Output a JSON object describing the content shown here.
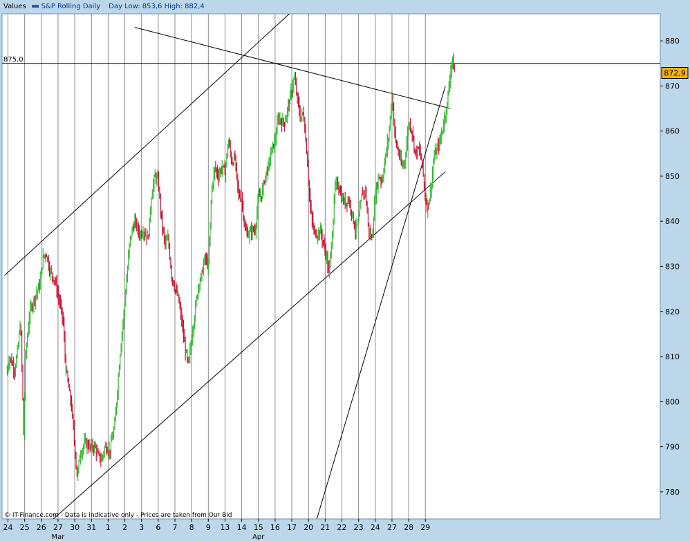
{
  "legend": {
    "values_label": "Values",
    "series_name": "S&P Rolling Daily",
    "day_range": "Day Low: 853,6 High: 882,4"
  },
  "footer_note": "© IT-Finance.com - Data is indicative only - Prices are taken from Our Bid",
  "colors": {
    "up": "#2db82d",
    "down": "#c8102e",
    "grid": "#888888",
    "background_plot": "#ffffff",
    "background_frame": "#bcd7ea",
    "price_marker": "#f4b400"
  },
  "chart_data": {
    "type": "candlestick",
    "title": "",
    "xlabel": "",
    "ylabel": "",
    "ylim": [
      774,
      886
    ],
    "y_ticks": [
      780,
      790,
      800,
      810,
      820,
      830,
      840,
      850,
      860,
      870,
      880
    ],
    "x_tick_labels": [
      "24",
      "25",
      "26",
      "27",
      "30",
      "31",
      "1",
      "2",
      "3",
      "6",
      "7",
      "8",
      "9",
      "13",
      "14",
      "15",
      "16",
      "17",
      "20",
      "21",
      "22",
      "23",
      "24",
      "27",
      "28",
      "29"
    ],
    "month_labels": [
      {
        "label": "Mar",
        "at_tick": "27"
      },
      {
        "label": "Apr",
        "at_tick": "15"
      }
    ],
    "horizontal_line": {
      "value": 875.0,
      "label": "875,0"
    },
    "last_price": {
      "value": 872.9,
      "label": "872,9"
    },
    "trendlines": [
      {
        "name": "upper-channel",
        "from": {
          "tick": -0.2,
          "value": 828
        },
        "to": {
          "tick": 24.2,
          "value": 911
        }
      },
      {
        "name": "lower-channel",
        "from": {
          "tick": 1.5,
          "value": 770
        },
        "to": {
          "tick": 26.2,
          "value": 851
        }
      },
      {
        "name": "descending-resistance",
        "from": {
          "tick": 7.6,
          "value": 883
        },
        "to": {
          "tick": 26.5,
          "value": 865
        }
      },
      {
        "name": "steep-support",
        "from": {
          "tick": 18.5,
          "value": 774
        },
        "to": {
          "tick": 26.2,
          "value": 870
        }
      }
    ],
    "anchors": [
      [
        -0.1,
        806
      ],
      [
        0.1,
        810
      ],
      [
        0.4,
        807
      ],
      [
        0.6,
        812
      ],
      [
        0.75,
        818
      ],
      [
        0.85,
        806
      ],
      [
        0.95,
        792
      ],
      [
        1.05,
        810
      ],
      [
        1.3,
        820
      ],
      [
        1.6,
        823
      ],
      [
        1.9,
        826
      ],
      [
        2.1,
        832
      ],
      [
        2.3,
        833
      ],
      [
        2.5,
        829
      ],
      [
        2.8,
        827
      ],
      [
        3.1,
        822
      ],
      [
        3.3,
        818
      ],
      [
        3.45,
        808
      ],
      [
        3.6,
        804
      ],
      [
        3.8,
        799
      ],
      [
        4.0,
        790
      ],
      [
        4.15,
        783
      ],
      [
        4.3,
        788
      ],
      [
        4.6,
        791
      ],
      [
        4.9,
        790
      ],
      [
        5.2,
        790
      ],
      [
        5.4,
        788
      ],
      [
        5.6,
        787
      ],
      [
        5.8,
        790
      ],
      [
        6.1,
        789
      ],
      [
        6.4,
        795
      ],
      [
        6.7,
        810
      ],
      [
        7.0,
        822
      ],
      [
        7.3,
        836
      ],
      [
        7.6,
        840
      ],
      [
        7.9,
        837
      ],
      [
        8.1,
        838
      ],
      [
        8.4,
        836
      ],
      [
        8.6,
        846
      ],
      [
        8.8,
        850
      ],
      [
        9.0,
        849
      ],
      [
        9.2,
        840
      ],
      [
        9.4,
        835
      ],
      [
        9.6,
        836
      ],
      [
        9.8,
        828
      ],
      [
        10.0,
        825
      ],
      [
        10.2,
        823
      ],
      [
        10.4,
        818
      ],
      [
        10.6,
        812
      ],
      [
        10.8,
        808
      ],
      [
        11.0,
        814
      ],
      [
        11.2,
        820
      ],
      [
        11.4,
        826
      ],
      [
        11.6,
        828
      ],
      [
        11.8,
        832
      ],
      [
        12.0,
        830
      ],
      [
        12.2,
        847
      ],
      [
        12.4,
        852
      ],
      [
        12.6,
        850
      ],
      [
        12.8,
        852
      ],
      [
        13.0,
        851
      ],
      [
        13.2,
        858
      ],
      [
        13.4,
        853
      ],
      [
        13.6,
        854
      ],
      [
        13.8,
        846
      ],
      [
        14.0,
        845
      ],
      [
        14.2,
        838
      ],
      [
        14.4,
        837
      ],
      [
        14.6,
        838
      ],
      [
        14.8,
        838
      ],
      [
        15.0,
        845
      ],
      [
        15.2,
        846
      ],
      [
        15.4,
        850
      ],
      [
        15.6,
        852
      ],
      [
        15.8,
        856
      ],
      [
        16.0,
        858
      ],
      [
        16.2,
        863
      ],
      [
        16.4,
        862
      ],
      [
        16.6,
        862
      ],
      [
        16.8,
        866
      ],
      [
        17.0,
        869
      ],
      [
        17.15,
        872
      ],
      [
        17.3,
        868
      ],
      [
        17.5,
        863
      ],
      [
        17.7,
        864
      ],
      [
        17.9,
        855
      ],
      [
        18.1,
        843
      ],
      [
        18.3,
        838
      ],
      [
        18.5,
        837
      ],
      [
        18.7,
        838
      ],
      [
        18.9,
        835
      ],
      [
        19.1,
        832
      ],
      [
        19.2,
        828
      ],
      [
        19.4,
        836
      ],
      [
        19.6,
        848
      ],
      [
        19.8,
        848
      ],
      [
        20.0,
        845
      ],
      [
        20.2,
        844
      ],
      [
        20.4,
        845
      ],
      [
        20.6,
        842
      ],
      [
        20.8,
        838
      ],
      [
        21.0,
        840
      ],
      [
        21.2,
        846
      ],
      [
        21.4,
        847
      ],
      [
        21.6,
        838
      ],
      [
        21.8,
        836
      ],
      [
        22.0,
        846
      ],
      [
        22.2,
        850
      ],
      [
        22.4,
        849
      ],
      [
        22.6,
        854
      ],
      [
        22.8,
        859
      ],
      [
        23.0,
        868
      ],
      [
        23.2,
        858
      ],
      [
        23.4,
        855
      ],
      [
        23.6,
        852
      ],
      [
        23.8,
        854
      ],
      [
        24.0,
        862
      ],
      [
        24.2,
        860
      ],
      [
        24.4,
        855
      ],
      [
        24.6,
        856
      ],
      [
        24.8,
        853
      ],
      [
        25.0,
        845
      ],
      [
        25.1,
        843
      ],
      [
        25.3,
        846
      ],
      [
        25.5,
        854
      ],
      [
        25.7,
        856
      ],
      [
        25.9,
        858
      ],
      [
        26.1,
        862
      ],
      [
        26.3,
        866
      ],
      [
        26.5,
        873
      ],
      [
        26.6,
        876
      ],
      [
        26.75,
        872.9
      ]
    ]
  }
}
